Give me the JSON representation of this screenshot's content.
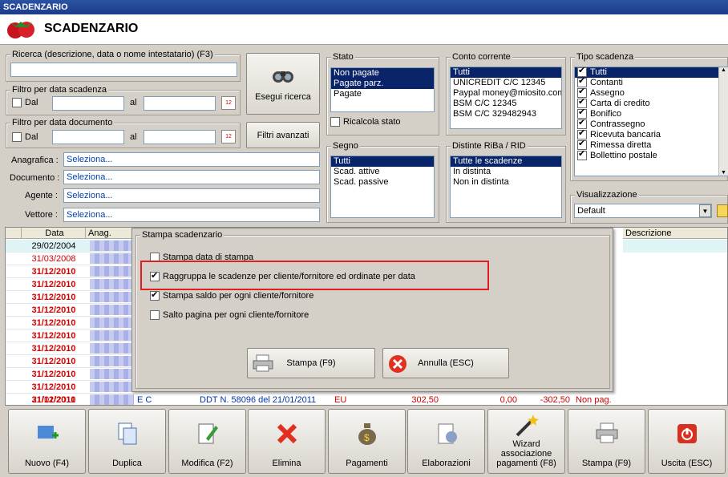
{
  "window": {
    "title": "SCADENZARIO"
  },
  "header": {
    "title": "SCADENZARIO"
  },
  "search": {
    "legend": "Ricerca (descrizione, data o nome intestatario) (F3)",
    "value": "",
    "exec_label": "Esegui ricerca",
    "advanced_label": "Filtri avanzati"
  },
  "filter_scadenza": {
    "legend": "Filtro per data scadenza",
    "dal": "Dal",
    "al": "al"
  },
  "filter_documento": {
    "legend": "Filtro per data documento",
    "dal": "Dal",
    "al": "al"
  },
  "fields": [
    {
      "label": "Anagrafica :",
      "value": "Seleziona..."
    },
    {
      "label": "Documento :",
      "value": "Seleziona..."
    },
    {
      "label": "Agente :",
      "value": "Seleziona..."
    },
    {
      "label": "Vettore :",
      "value": "Seleziona..."
    }
  ],
  "stato": {
    "legend": "Stato",
    "items": [
      "Non pagate",
      "Pagate parz.",
      "Pagate"
    ],
    "selected": [
      0,
      1
    ],
    "ricalcola": "Ricalcola stato"
  },
  "segno": {
    "legend": "Segno",
    "items": [
      "Tutti",
      "Scad. attive",
      "Scad. passive"
    ],
    "selected": [
      0
    ]
  },
  "conto": {
    "legend": "Conto corrente",
    "items": [
      "Tutti",
      "UNICREDIT C/C 12345",
      "Paypal money@miosito.com",
      "BSM C/C 12345",
      "BSM C/C 329482943"
    ],
    "selected": [
      0
    ]
  },
  "distinte": {
    "legend": "Distinte RiBa / RID",
    "items": [
      "Tutte le scadenze",
      "In distinta",
      "Non in distinta"
    ],
    "selected": [
      0
    ]
  },
  "tipo": {
    "legend": "Tipo scadenza",
    "items": [
      "Tutti",
      "Contanti",
      "Assegno",
      "Carta di credito",
      "Bonifico",
      "Contrassegno",
      "Ricevuta bancaria",
      "Rimessa diretta",
      "Bollettino postale"
    ],
    "selected": [
      0
    ]
  },
  "visualizzazione": {
    "legend": "Visualizzazione",
    "value": "Default"
  },
  "grid": {
    "columns": [
      "Data",
      "Anag.",
      "Descrizione"
    ],
    "dates": [
      "29/02/2004",
      "31/03/2008",
      "31/12/2010",
      "31/12/2010",
      "31/12/2010",
      "31/12/2010",
      "31/12/2010",
      "31/12/2010",
      "31/12/2010",
      "31/12/2010",
      "31/12/2010",
      "31/12/2010",
      "31/12/2010"
    ],
    "last_row": {
      "date": "21/01/2011",
      "anag": "E C",
      "doc": "DDT N. 58096 del 21/01/2011",
      "cur": "EU",
      "amount": "302,50",
      "paid": "0,00",
      "rest": "-302,50",
      "status": "Non pag."
    }
  },
  "dialog": {
    "legend": "Stampa scadenzario",
    "options": [
      {
        "label": "Stampa data di stampa",
        "checked": false
      },
      {
        "label": "Raggruppa le scadenze per cliente/fornitore ed ordinate per data",
        "checked": true
      },
      {
        "label": "Stampa saldo per ogni cliente/fornitore",
        "checked": true
      },
      {
        "label": "Salto pagina per ogni cliente/fornitore",
        "checked": false
      }
    ],
    "print_label": "Stampa (F9)",
    "cancel_label": "Annulla (ESC)"
  },
  "toolbar": [
    {
      "label": "Nuovo (F4)",
      "icon": "new-icon"
    },
    {
      "label": "Duplica",
      "icon": "duplicate-icon"
    },
    {
      "label": "Modifica (F2)",
      "icon": "edit-icon"
    },
    {
      "label": "Elimina",
      "icon": "delete-icon"
    },
    {
      "label": "Pagamenti",
      "icon": "money-bag-icon"
    },
    {
      "label": "Elaborazioni",
      "icon": "process-icon"
    },
    {
      "label": "Wizard associazione pagamenti (F8)",
      "icon": "wizard-icon"
    },
    {
      "label": "Stampa (F9)",
      "icon": "printer-icon"
    },
    {
      "label": "Uscita (ESC)",
      "icon": "exit-icon"
    }
  ],
  "colors": {
    "highlight": "#e02020",
    "selection": "#0a246a",
    "overdue": "#d00000"
  }
}
